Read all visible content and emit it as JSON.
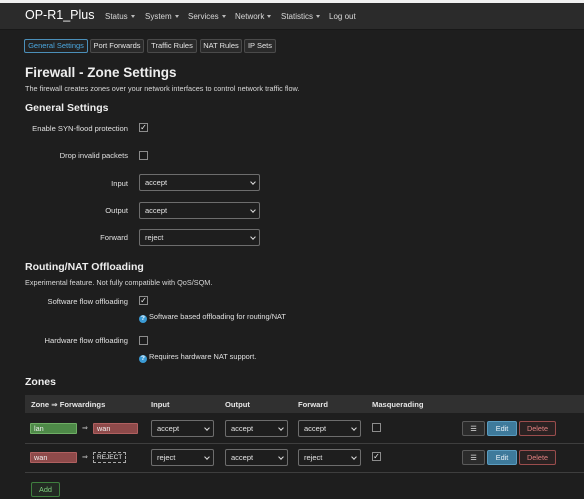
{
  "app": {
    "title": "OP-R1_Plus"
  },
  "nav": {
    "status": "Status",
    "system": "System",
    "services": "Services",
    "network": "Network",
    "statistics": "Statistics",
    "logout": "Log out"
  },
  "tabs": [
    "General Settings",
    "Port Forwards",
    "Traffic Rules",
    "NAT Rules",
    "IP Sets"
  ],
  "page": {
    "title": "Firewall - Zone Settings",
    "description": "The firewall creates zones over your network interfaces to control network traffic flow."
  },
  "general": {
    "heading": "General Settings",
    "syn_label": "Enable SYN-flood protection",
    "syn_checked": true,
    "drop_label": "Drop invalid packets",
    "drop_checked": false,
    "input_label": "Input",
    "input_value": "accept",
    "output_label": "Output",
    "output_value": "accept",
    "forward_label": "Forward",
    "forward_value": "reject"
  },
  "offload": {
    "heading": "Routing/NAT Offloading",
    "description": "Experimental feature. Not fully compatible with QoS/SQM.",
    "software_label": "Software flow offloading",
    "software_checked": true,
    "software_help": "Software based offloading for routing/NAT",
    "hardware_label": "Hardware flow offloading",
    "hardware_checked": false,
    "hardware_help": "Requires hardware NAT support."
  },
  "zones": {
    "heading": "Zones",
    "columns": [
      "Zone ⇒ Forwardings",
      "Input",
      "Output",
      "Forward",
      "Masquerading"
    ],
    "rows": [
      {
        "zone": "lan",
        "zone_color": "#4e8a48",
        "target": "wan",
        "input": "accept",
        "output": "accept",
        "forward": "accept",
        "masq": false
      },
      {
        "zone": "wan",
        "zone_color": "#8e4a4a",
        "target": "REJECT",
        "input": "reject",
        "output": "accept",
        "forward": "reject",
        "masq": true
      }
    ],
    "menu_icon": "☰",
    "edit": "Edit",
    "delete": "Delete",
    "add": "Add"
  },
  "colors": {
    "accent": "#3e7a9b",
    "link": "#4ba7df",
    "lan": "#4e8a48",
    "wan": "#8e4a4a"
  }
}
